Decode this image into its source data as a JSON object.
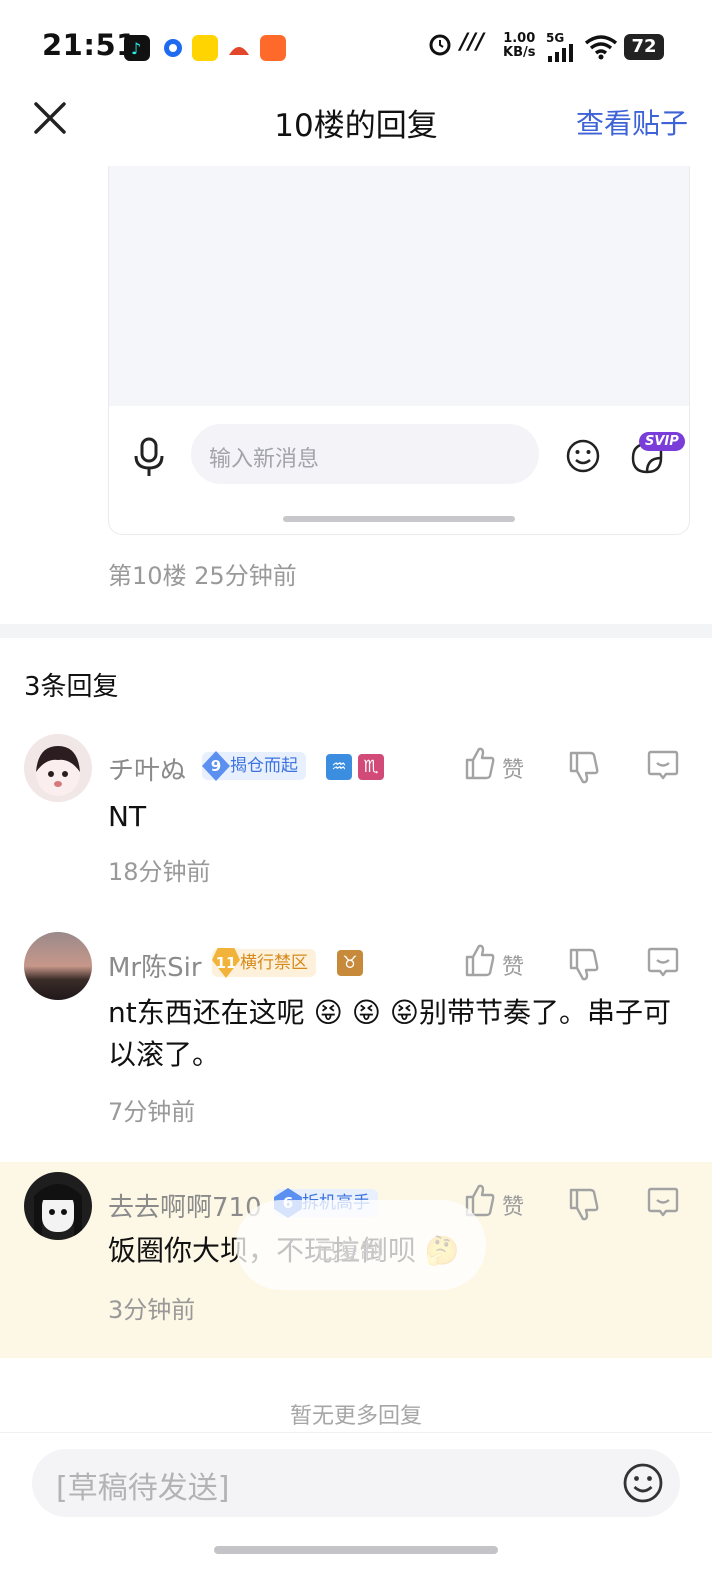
{
  "status_bar": {
    "time": "21:51",
    "network_speed": "1.00",
    "network_unit": "KB/s",
    "signal": "5G",
    "battery": "72",
    "app_icons": [
      "tiktok-icon",
      "browser-icon",
      "calendar-app-icon",
      "game-app-icon",
      "grid-app-icon"
    ]
  },
  "header": {
    "title": "10楼的回复",
    "view_post": "查看贴子"
  },
  "card": {
    "input_placeholder": "输入新消息",
    "svip": "SVIP"
  },
  "floor": {
    "meta": "第10楼 25分钟前"
  },
  "replies": {
    "count_label": "3条回复",
    "actions": {
      "like": "赞"
    },
    "items": [
      {
        "username": "チ叶ぬ",
        "badge_level": "9",
        "badge_text": "揭仓而起",
        "text": "NT",
        "time": "18分钟前"
      },
      {
        "username": "Mr陈Sir",
        "badge_level": "11",
        "badge_text": "横行禁区",
        "text": "nt东西还在这呢 😝 😝 😝别带节奏了。串子可以滚了。",
        "time": "7分钟前"
      },
      {
        "username": "去去啊啊710",
        "badge_level": "6",
        "badge_text": "拆机高手",
        "text": "饭圈你大坝，不玩拉倒呗 🤔",
        "time": "3分钟前"
      }
    ],
    "toast": "已复制",
    "no_more": "暂无更多回复"
  },
  "bottom": {
    "draft_placeholder": "[草稿待发送]"
  },
  "colors": {
    "accent": "#3e63d6",
    "highlight": "#fdf8e6",
    "badge_blue": "#e8f0fd",
    "badge_gold": "#fdf1dc"
  }
}
